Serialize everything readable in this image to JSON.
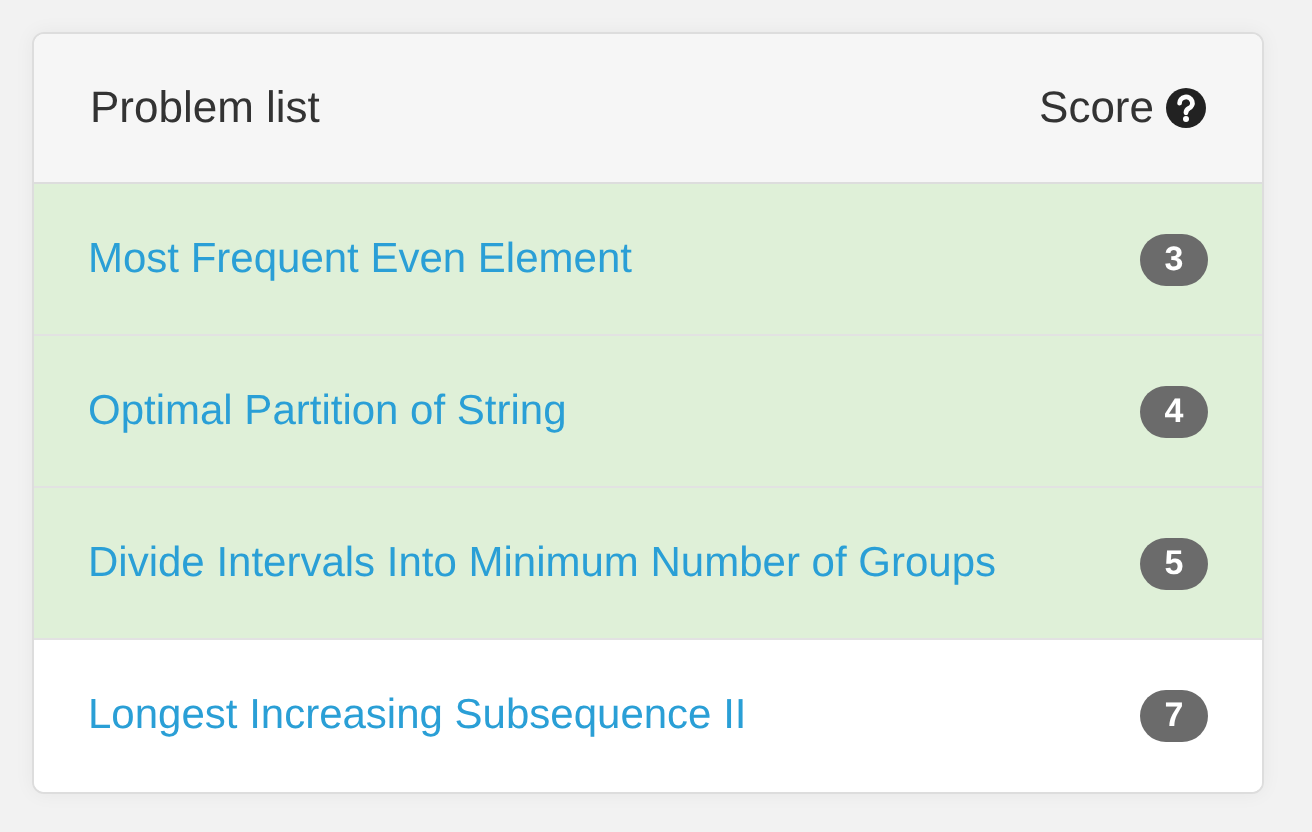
{
  "header": {
    "title": "Problem list",
    "score_label": "Score"
  },
  "problems": [
    {
      "title": "Most Frequent Even Element",
      "score": "3",
      "solved": true
    },
    {
      "title": "Optimal Partition of String",
      "score": "4",
      "solved": true
    },
    {
      "title": "Divide Intervals Into Minimum Number of Groups",
      "score": "5",
      "solved": true
    },
    {
      "title": "Longest Increasing Subsequence II",
      "score": "7",
      "solved": false
    }
  ]
}
